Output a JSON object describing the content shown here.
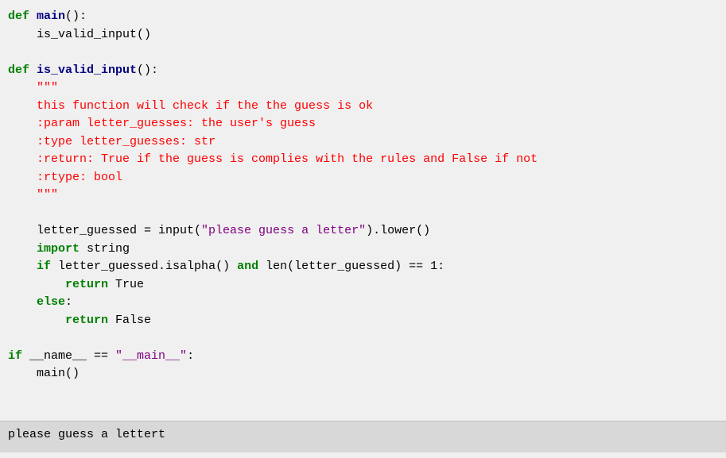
{
  "code": {
    "lines": [
      {
        "id": "line1",
        "content": [
          {
            "text": "def ",
            "class": "kw-def"
          },
          {
            "text": "main",
            "class": "fn-name"
          },
          {
            "text": "():",
            "class": "normal"
          }
        ]
      },
      {
        "id": "line2",
        "content": [
          {
            "text": "    is_valid_input()",
            "class": "normal"
          }
        ]
      },
      {
        "id": "line3",
        "content": [
          {
            "text": "",
            "class": "normal"
          }
        ]
      },
      {
        "id": "line4",
        "content": [
          {
            "text": "def ",
            "class": "kw-def"
          },
          {
            "text": "is_valid_input",
            "class": "fn-name"
          },
          {
            "text": "():",
            "class": "normal"
          }
        ]
      },
      {
        "id": "line5",
        "content": [
          {
            "text": "    \"\"\"",
            "class": "docstring"
          }
        ]
      },
      {
        "id": "line6",
        "content": [
          {
            "text": "    this function will check if the the guess is ok",
            "class": "docstring"
          }
        ]
      },
      {
        "id": "line7",
        "content": [
          {
            "text": "    :param letter_guesses: the user's guess",
            "class": "docstring"
          }
        ]
      },
      {
        "id": "line8",
        "content": [
          {
            "text": "    :type letter_guesses: str",
            "class": "docstring"
          }
        ]
      },
      {
        "id": "line9",
        "content": [
          {
            "text": "    :return: True if the guess is complies with the rules and False if not",
            "class": "docstring"
          }
        ]
      },
      {
        "id": "line10",
        "content": [
          {
            "text": "    :rtype: bool",
            "class": "docstring"
          }
        ]
      },
      {
        "id": "line11",
        "content": [
          {
            "text": "    \"\"\"",
            "class": "docstring"
          }
        ]
      },
      {
        "id": "line12",
        "content": [
          {
            "text": "",
            "class": "normal"
          }
        ]
      },
      {
        "id": "line13",
        "content": [
          {
            "text": "    letter_guessed = input(",
            "class": "normal"
          },
          {
            "text": "\"please guess a letter\"",
            "class": "string"
          },
          {
            "text": ").lower()",
            "class": "normal"
          }
        ]
      },
      {
        "id": "line14",
        "content": [
          {
            "text": "    ",
            "class": "normal"
          },
          {
            "text": "import",
            "class": "kw-import"
          },
          {
            "text": " string",
            "class": "normal"
          }
        ]
      },
      {
        "id": "line15",
        "content": [
          {
            "text": "    ",
            "class": "normal"
          },
          {
            "text": "if",
            "class": "kw-if"
          },
          {
            "text": " letter_guessed.isalpha() ",
            "class": "normal"
          },
          {
            "text": "and",
            "class": "kw-and"
          },
          {
            "text": " len(letter_guessed) == 1:",
            "class": "normal"
          }
        ]
      },
      {
        "id": "line16",
        "content": [
          {
            "text": "        ",
            "class": "normal"
          },
          {
            "text": "return",
            "class": "kw-return"
          },
          {
            "text": " True",
            "class": "normal"
          }
        ]
      },
      {
        "id": "line17",
        "content": [
          {
            "text": "    ",
            "class": "normal"
          },
          {
            "text": "else",
            "class": "kw-else"
          },
          {
            "text": ":",
            "class": "normal"
          }
        ]
      },
      {
        "id": "line18",
        "content": [
          {
            "text": "        ",
            "class": "normal"
          },
          {
            "text": "return",
            "class": "kw-return"
          },
          {
            "text": " False",
            "class": "normal"
          }
        ]
      },
      {
        "id": "line19",
        "content": [
          {
            "text": "",
            "class": "normal"
          }
        ]
      },
      {
        "id": "line20",
        "content": [
          {
            "text": "if",
            "class": "kw-if"
          },
          {
            "text": " __name__ == ",
            "class": "normal"
          },
          {
            "text": "\"__main__\"",
            "class": "string"
          },
          {
            "text": ":",
            "class": "normal"
          }
        ]
      },
      {
        "id": "line21",
        "content": [
          {
            "text": "    main()",
            "class": "normal"
          }
        ]
      }
    ]
  },
  "output": {
    "text": "please guess a lettert"
  }
}
